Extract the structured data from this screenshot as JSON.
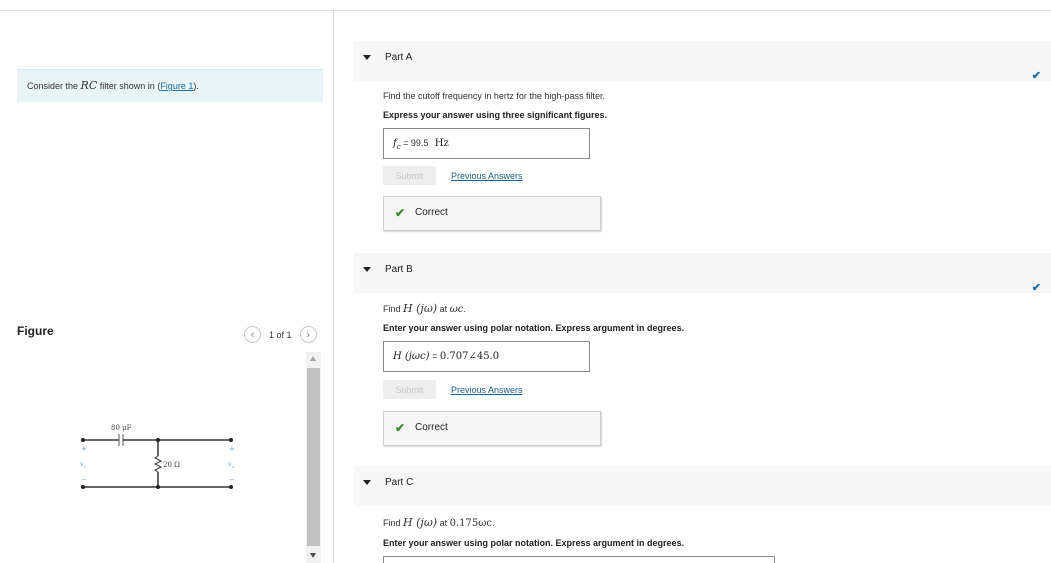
{
  "intro": {
    "prefix": "Consider the",
    "math": "RC",
    "middle": "filter shown in",
    "open_paren": "(",
    "link": "Figure 1",
    "close": ")."
  },
  "figure": {
    "label": "Figure",
    "count": "1 of 1",
    "prev_icon": "chevron-left-icon",
    "next_icon": "chevron-right-icon",
    "capacitor_label": "80 μF",
    "resistor_label": "20 Ω",
    "input_label": "v",
    "input_sub": "i",
    "output_label": "v",
    "output_sub": "o",
    "plus": "+",
    "minus": "−"
  },
  "parts": [
    {
      "title": "Part A",
      "question": "Find the cutoff frequency in hertz for the high-pass filter.",
      "instruction": "Express your answer using three significant figures.",
      "answer_var": "f",
      "answer_sub": "c",
      "equals": " = ",
      "answer_value": "99.5",
      "answer_unit": "Hz",
      "submit": "Submit",
      "previous": "Previous Answers",
      "result": "Correct"
    },
    {
      "title": "Part B",
      "question_prefix": "Find",
      "question_math": "H (jω)",
      "question_mid": "at",
      "question_math2": "ωc",
      "question_end": ".",
      "instruction": "Enter your answer using polar notation. Express argument in degrees.",
      "answer_lhs": "H (jωc)",
      "equals": " = ",
      "answer_value": "0.707∠45.0",
      "submit": "Submit",
      "previous": "Previous Answers",
      "result": "Correct"
    },
    {
      "title": "Part C",
      "question_prefix": "Find",
      "question_math": "H (jω)",
      "question_mid": "at",
      "question_math2": "0.175ωc",
      "question_end": ".",
      "instruction": "Enter your answer using polar notation. Express argument in degrees."
    }
  ],
  "colors": {
    "accent": "#1a6ea8",
    "correct": "#3a8a2e",
    "intro_bg": "#e8f4f6"
  }
}
